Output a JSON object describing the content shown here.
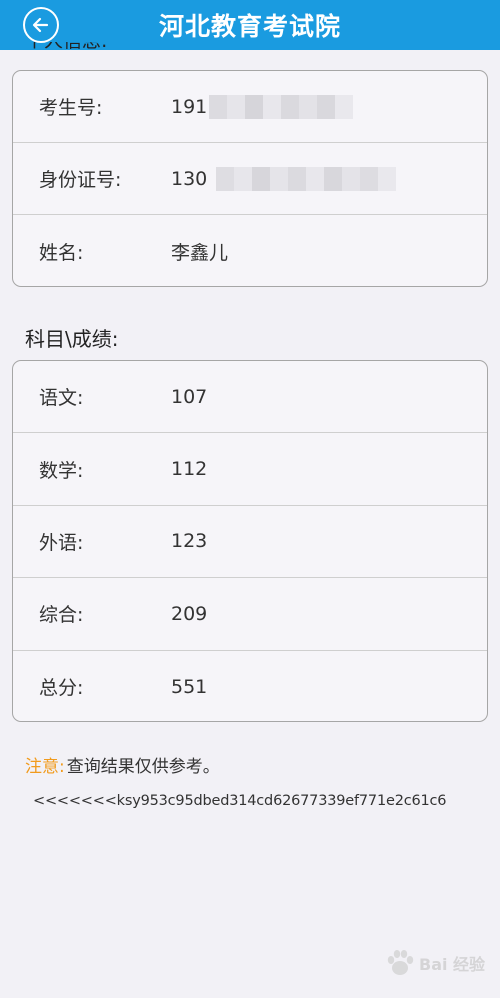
{
  "header": {
    "title": "河北教育考试院",
    "back_icon": "arrow-left-circle-icon"
  },
  "personal_section": {
    "title": "个人信息:",
    "rows": [
      {
        "label": "考生号:",
        "value": "191"
      },
      {
        "label": "身份证号:",
        "value": "130"
      },
      {
        "label": "姓名:",
        "value": "李鑫儿"
      }
    ]
  },
  "scores_section": {
    "title": "科目\\成绩:",
    "rows": [
      {
        "label": "语文:",
        "value": "107"
      },
      {
        "label": "数学:",
        "value": "112"
      },
      {
        "label": "外语:",
        "value": "123"
      },
      {
        "label": "综合:",
        "value": "209"
      },
      {
        "label": "总分:",
        "value": "551"
      }
    ]
  },
  "note": {
    "label": "注意:",
    "text": "查询结果仅供参考。"
  },
  "code_line": "<<<<<<<ksy953c95dbed314cd62677339ef771e2c61c6",
  "watermark": {
    "text": "Bai 经验",
    "icon": "baidu-paw-icon"
  },
  "colors": {
    "header_bg": "#1a9be0",
    "note_label": "#f19b1d",
    "page_bg": "#f2f1f6"
  }
}
